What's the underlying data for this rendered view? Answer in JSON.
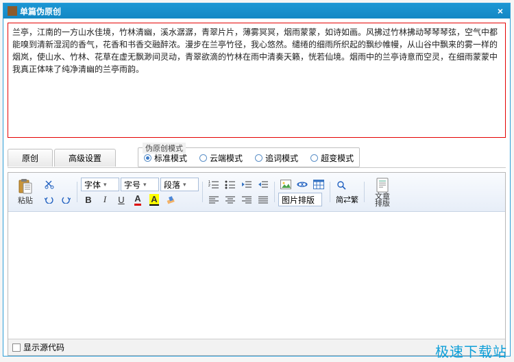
{
  "window": {
    "title": "单篇伪原创"
  },
  "source_text": "兰亭，江南的一方山水佳境，竹林清幽，溪水潺潺，青翠片片，薄雾冥冥，烟雨蒙蒙，如诗如画。风拂过竹林拂动琴琴琴弦，空气中都能嗅到清新湿润的香气，花香和书香交融醉浓。漫步在兰亭竹径，我心悠然。缱绻的细雨所织起的飘纱帷幔，从山谷中飘来的雾一样的烟岚，使山水、竹林、花草在虚无飘渺间灵动，青翠欲滴的竹林在雨中清奏天籁，恍若仙境。烟雨中的兰亭诗意而空灵，在细雨蒙蒙中我真正体味了纯净清幽的兰亭雨韵。",
  "tabs": {
    "original": "原创",
    "advanced": "高级设置"
  },
  "mode_group": {
    "legend": "伪原创模式",
    "standard": "标准模式",
    "cloud": "云端模式",
    "query": "追词模式",
    "super": "超变模式"
  },
  "toolbar": {
    "paste": "粘贴",
    "font_family": "字体",
    "font_size": "字号",
    "paragraph": "段落",
    "image_layout": "图片排版",
    "simp_trad": "简⇄繁",
    "article_layout": "文章排版"
  },
  "bottom": {
    "show_source": "显示源代码"
  },
  "watermark": "极速下载站"
}
